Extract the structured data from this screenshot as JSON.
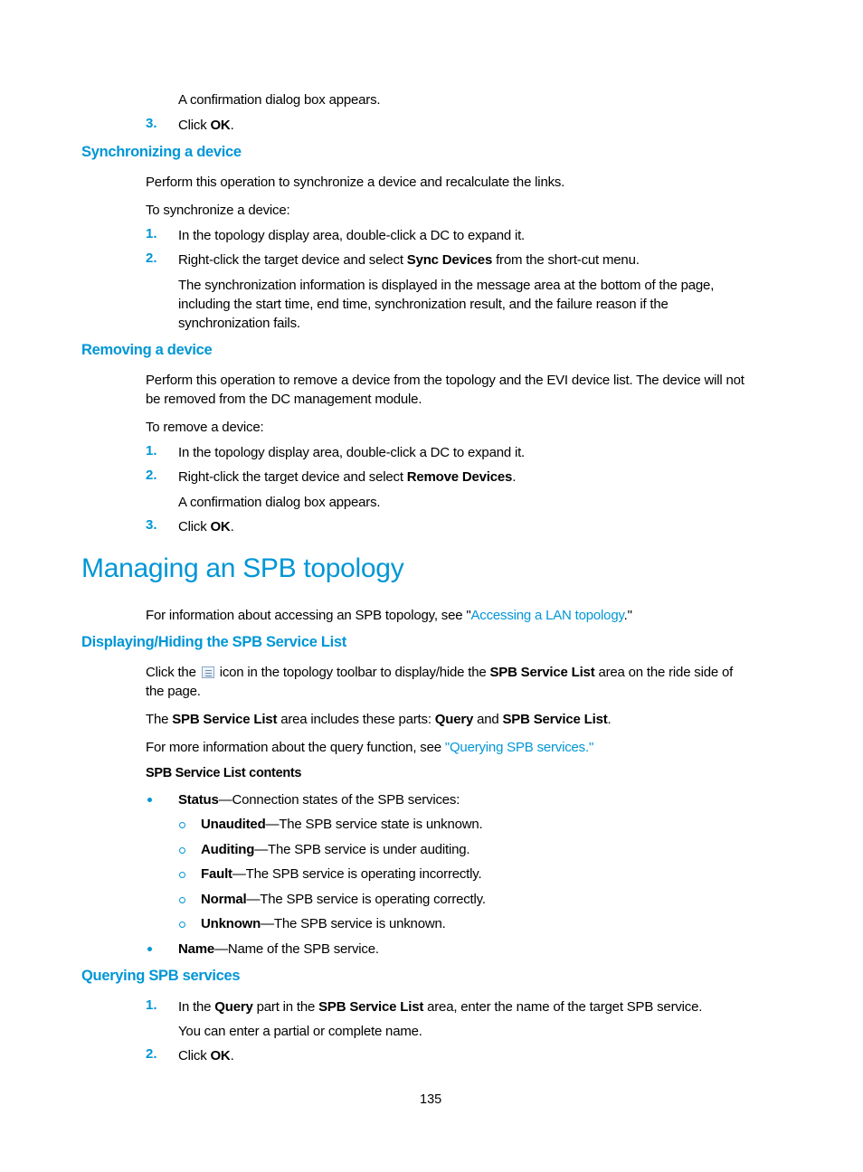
{
  "blocks": {
    "p_confirm1": "A confirmation dialog box appears.",
    "step3a": {
      "num": "3.",
      "segments": [
        {
          "t": "Click "
        },
        {
          "t": "OK",
          "b": true
        },
        {
          "t": "."
        }
      ]
    },
    "h_sync": "Synchronizing a device",
    "p_sync_intro": "Perform this operation to synchronize a device and recalculate the links.",
    "p_sync_to": "To synchronize a device:",
    "sync_step1": {
      "num": "1.",
      "text": "In the topology display area, double-click a DC to expand it."
    },
    "sync_step2": {
      "num": "2.",
      "segments": [
        {
          "t": "Right-click the target device and select "
        },
        {
          "t": "Sync Devices",
          "b": true
        },
        {
          "t": " from the short-cut menu."
        }
      ]
    },
    "sync_note": [
      "The synchronization information is displayed in the message area at the bottom of the page,",
      "including the start time, end time, synchronization result, and the failure reason if the",
      "synchronization fails."
    ],
    "h_remove": "Removing a device",
    "p_remove_intro": [
      "Perform this operation to remove a device from the topology and the EVI device list. The device will not",
      "be removed from the DC management module."
    ],
    "p_remove_to": "To remove a device:",
    "remove_step1": {
      "num": "1.",
      "text": "In the topology display area, double-click a DC to expand it."
    },
    "remove_step2": {
      "num": "2.",
      "segments": [
        {
          "t": "Right-click the target device and select "
        },
        {
          "t": "Remove Devices",
          "b": true
        },
        {
          "t": "."
        }
      ]
    },
    "p_confirm2": "A confirmation dialog box appears.",
    "remove_step3": {
      "num": "3.",
      "segments": [
        {
          "t": "Click "
        },
        {
          "t": "OK",
          "b": true
        },
        {
          "t": "."
        }
      ]
    },
    "h1_spb": "Managing an SPB topology",
    "p_spb_access": {
      "segments": [
        {
          "t": "For information about accessing an SPB topology, see \""
        },
        {
          "t": "Accessing a LAN topology",
          "link": true
        },
        {
          "t": ".\""
        }
      ]
    },
    "h_display": "Displaying/Hiding the SPB Service List",
    "p_click_icon_line1": {
      "before": "Click the",
      "icon": "service-list-icon",
      "segments": [
        {
          "t": "icon in the topology toolbar to display/hide the "
        },
        {
          "t": "SPB Service List",
          "b": true
        },
        {
          "t": " area on the ride side of"
        }
      ]
    },
    "p_click_icon_line2": "the page.",
    "p_parts": {
      "segments": [
        {
          "t": "The "
        },
        {
          "t": "SPB Service List",
          "b": true
        },
        {
          "t": " area includes these parts: "
        },
        {
          "t": "Query",
          "b": true
        },
        {
          "t": " and "
        },
        {
          "t": "SPB Service List",
          "b": true
        },
        {
          "t": "."
        }
      ]
    },
    "p_more": {
      "segments": [
        {
          "t": "For more information about the query function, see "
        },
        {
          "t": "\"Querying SPB services.\"",
          "link": true
        }
      ]
    },
    "sub_contents": "SPB Service List contents",
    "bullet_status": {
      "label": "Status",
      "desc": "—Connection states of the SPB services:"
    },
    "status_items": [
      {
        "label": "Unaudited",
        "desc": "—The SPB service state is unknown."
      },
      {
        "label": "Auditing",
        "desc": "—The SPB service is under auditing."
      },
      {
        "label": "Fault",
        "desc": "—The SPB service is operating incorrectly."
      },
      {
        "label": "Normal",
        "desc": "—The SPB service is operating correctly."
      },
      {
        "label": "Unknown",
        "desc": "—The SPB service is unknown."
      }
    ],
    "bullet_name": {
      "label": "Name",
      "desc": "—Name of the SPB service."
    },
    "h_query": "Querying SPB services",
    "query_step1": {
      "num": "1.",
      "segments": [
        {
          "t": "In the "
        },
        {
          "t": "Query",
          "b": true
        },
        {
          "t": " part in the "
        },
        {
          "t": "SPB Service List",
          "b": true
        },
        {
          "t": " area, enter the name of the target SPB service."
        }
      ]
    },
    "query_note": "You can enter a partial or complete name.",
    "query_step2": {
      "num": "2.",
      "segments": [
        {
          "t": "Click "
        },
        {
          "t": "OK",
          "b": true
        },
        {
          "t": "."
        }
      ]
    }
  },
  "footer": {
    "page_number": "135"
  },
  "colors": {
    "accent": "#0096d6",
    "text": "#000000"
  }
}
